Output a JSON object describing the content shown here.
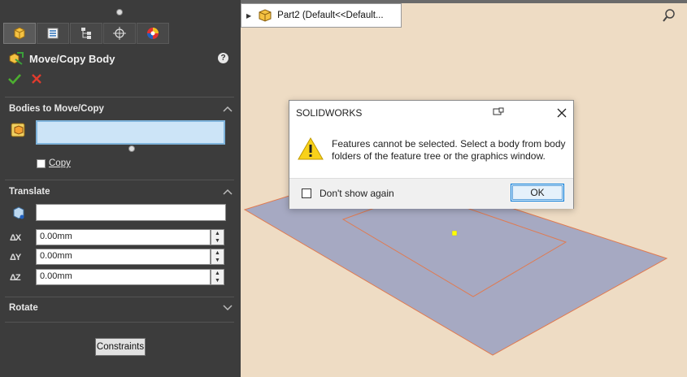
{
  "property_manager": {
    "title": "Move/Copy Body",
    "help_label": "?",
    "sections": {
      "bodies": {
        "header": "Bodies to Move/Copy",
        "copy_label": "Copy"
      },
      "translate": {
        "header": "Translate",
        "dx_label": "ΔX",
        "dx_value": "0.00mm",
        "dy_label": "ΔY",
        "dy_value": "0.00mm",
        "dz_label": "ΔZ",
        "dz_value": "0.00mm"
      },
      "rotate": {
        "header": "Rotate"
      }
    },
    "constraints_label": "Constraints"
  },
  "graphics": {
    "breadcrumb": "Part2  (Default<<Default..."
  },
  "dialog": {
    "title": "SOLIDWORKS",
    "message": "Features cannot be selected. Select a body from body folders of the feature tree or the graphics window.",
    "dont_show_label": "Don't show again",
    "ok_label": "OK"
  },
  "colors": {
    "panel_bg": "#3c3c3c",
    "viewport_bg": "#eedcc4",
    "plane_fill": "#a6a9c2",
    "plane_edge": "#e07a50",
    "selection_blue": "#cce4f7",
    "accent_blue": "#0078d7"
  }
}
